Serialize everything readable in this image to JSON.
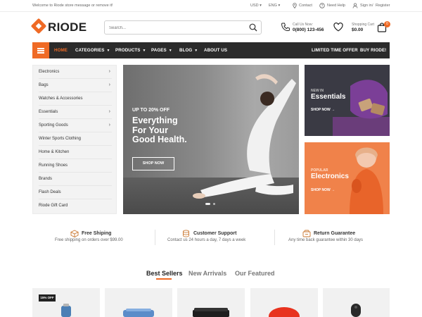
{
  "topbar": {
    "welcome": "Welcome to Riode store message or remove it!",
    "currency": "USD",
    "language": "ENG",
    "contact": "Contact",
    "help": "Need Help",
    "signin": "Sign in",
    "separator": "/",
    "register": "Register"
  },
  "header": {
    "logo": "RIODE",
    "search_placeholder": "Search...",
    "call_label": "Call Us Now:",
    "phone": "0(800) 123-456",
    "cart_label": "Shopping Cart",
    "cart_total": "$0.00",
    "cart_count": "0"
  },
  "nav": {
    "items": [
      {
        "label": "HOME",
        "active": true,
        "dropdown": false
      },
      {
        "label": "CATEGORIES",
        "dropdown": true
      },
      {
        "label": "PRODUCTS",
        "dropdown": true
      },
      {
        "label": "PAGES",
        "dropdown": true
      },
      {
        "label": "BLOG",
        "dropdown": true
      },
      {
        "label": "ABOUT US",
        "dropdown": false
      }
    ],
    "right": [
      "LIMITED TIME OFFER",
      "BUY RIODE!"
    ]
  },
  "sidebar": {
    "items": [
      {
        "label": "Electronics",
        "arrow": true
      },
      {
        "label": "Bags",
        "arrow": true
      },
      {
        "label": "Watches & Accessories",
        "arrow": false
      },
      {
        "label": "Essentials",
        "arrow": true
      },
      {
        "label": "Sporting Goods",
        "arrow": true
      },
      {
        "label": "Winter Sports Clothing",
        "arrow": false
      },
      {
        "label": "Home & Kitchen",
        "arrow": false
      },
      {
        "label": "Running Shoes",
        "arrow": false
      },
      {
        "label": "Brands",
        "arrow": false
      },
      {
        "label": "Flash Deals",
        "arrow": false
      },
      {
        "label": "Riode Gift Card",
        "arrow": false
      }
    ]
  },
  "hero": {
    "pretitle": "UP TO 20% OFF",
    "title_line1": "Everything",
    "title_line2": "For Your",
    "title_line3": "Good Health.",
    "button": "SHOP NOW"
  },
  "promos": [
    {
      "small": "NEW IN",
      "big": "Essentials",
      "shop": "SHOP NOW",
      "small_color": "#bdbdbd"
    },
    {
      "small": "POPULAR",
      "big": "Electronics",
      "shop": "SHOP NOW",
      "small_color": "#ffe0cc"
    }
  ],
  "features": [
    {
      "title": "Free Shiping",
      "sub": "Free shipping on orders over $99.00"
    },
    {
      "title": "Customer Support",
      "sub": "Contact us 24 hours a day, 7 days a week"
    },
    {
      "title": "Return Guarantee",
      "sub": "Any time back guarantee within 30 days"
    }
  ],
  "tabs": [
    "Best Sellers",
    "New Arrivals",
    "Our Featured"
  ],
  "product_badge": "15% OFF",
  "colors": {
    "accent": "#ef6a25",
    "dark": "#2b2b2b"
  }
}
